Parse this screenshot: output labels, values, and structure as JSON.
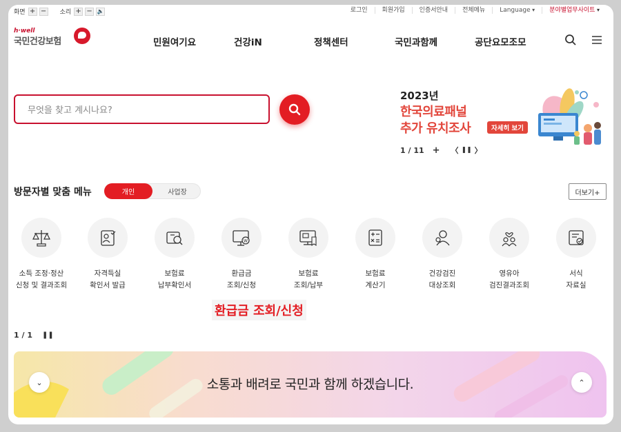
{
  "utility": {
    "font_label": "화면",
    "sound_label": "소리",
    "plus": "+",
    "minus": "−",
    "speaker": "🔈",
    "links": [
      "로그인",
      "회원가입",
      "인증서안내",
      "전체메뉴",
      "Language",
      "분야별업무사이트"
    ]
  },
  "logo": {
    "top": "h·well",
    "name": "국민건강보험"
  },
  "nav": [
    "민원여기요",
    "건강iN",
    "정책센터",
    "국민과함께",
    "공단요모조모"
  ],
  "search": {
    "placeholder": "무엇을 찾고 계시나요?"
  },
  "banner": {
    "year": "2023년",
    "title_line1": "한국의료패널",
    "title_line2": "추가 유치조사",
    "more": "자세히 보기",
    "counter": "1 / 11",
    "plus": "+",
    "prev": "〈",
    "pause": "❚❚",
    "next": "〉"
  },
  "visitor_menu": {
    "title": "방문자별 맞춤 메뉴",
    "tabs": [
      "개인",
      "사업장"
    ],
    "active_tab": "개인",
    "more": "더보기+",
    "items": [
      {
        "line1": "소득 조정·정산",
        "line2": "신청 및 결과조회",
        "icon": "scale-icon"
      },
      {
        "line1": "자격득실",
        "line2": "확인서 발급",
        "icon": "certificate-icon"
      },
      {
        "line1": "보험료",
        "line2": "납부확인서",
        "icon": "payment-search-icon"
      },
      {
        "line1": "환급금",
        "line2": "조회/신청",
        "icon": "refund-monitor-icon"
      },
      {
        "line1": "보험료",
        "line2": "조회/납부",
        "icon": "bill-screen-icon"
      },
      {
        "line1": "보험료",
        "line2": "계산기",
        "icon": "calculator-icon"
      },
      {
        "line1": "건강검진",
        "line2": "대상조회",
        "icon": "checkup-person-icon"
      },
      {
        "line1": "영유아",
        "line2": "검진결과조회",
        "icon": "infant-icon"
      },
      {
        "line1": "서식",
        "line2": "자료실",
        "icon": "form-doc-icon"
      }
    ],
    "callout": "환급금 조회/신청",
    "pager": "1 / 1",
    "pause": "❚❚"
  },
  "slogan": {
    "text": "소통과 배려로 국민과 함께 하겠습니다.",
    "down": "⌄",
    "up": "⌃"
  },
  "colors": {
    "brand_red": "#e31d23",
    "banner_orange": "#e2463b"
  }
}
